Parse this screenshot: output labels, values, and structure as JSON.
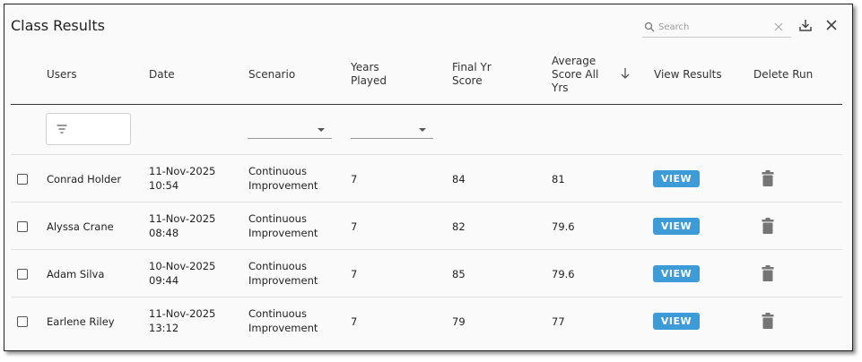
{
  "header": {
    "title": "Class Results",
    "search_placeholder": "Search",
    "search_value": ""
  },
  "columns": {
    "users": "Users",
    "date": "Date",
    "scenario": "Scenario",
    "years_played": [
      "Years",
      "Played"
    ],
    "final_score": [
      "Final Yr",
      "Score"
    ],
    "average_score": [
      "Average",
      "Score All",
      "Yrs"
    ],
    "view_results": "View Results",
    "delete_run": "Delete Run"
  },
  "sort": {
    "column": "average_score",
    "direction": "descending"
  },
  "rows": [
    {
      "user": "Conrad Holder",
      "date": "11-Nov-2025",
      "time": "10:54",
      "scenario": [
        "Continuous",
        "Improvement"
      ],
      "years": "7",
      "final": "84",
      "average": "81",
      "view_label": "VIEW"
    },
    {
      "user": "Alyssa Crane",
      "date": "11-Nov-2025",
      "time": "08:48",
      "scenario": [
        "Continuous",
        "Improvement"
      ],
      "years": "7",
      "final": "82",
      "average": "79.6",
      "view_label": "VIEW"
    },
    {
      "user": "Adam Silva",
      "date": "10-Nov-2025",
      "time": "09:44",
      "scenario": [
        "Continuous",
        "Improvement"
      ],
      "years": "7",
      "final": "85",
      "average": "79.6",
      "view_label": "VIEW"
    },
    {
      "user": "Earlene Riley",
      "date": "11-Nov-2025",
      "time": "13:12",
      "scenario": [
        "Continuous",
        "Improvement"
      ],
      "years": "7",
      "final": "79",
      "average": "77",
      "view_label": "VIEW"
    }
  ],
  "colors": {
    "view_button": "#3d9bd8",
    "trash_icon": "#757575"
  },
  "icons": [
    "search-icon",
    "clear-icon",
    "download-icon",
    "close-icon",
    "sort-arrow-down-icon",
    "filter-icon",
    "dropdown-caret-icon",
    "trash-icon"
  ]
}
